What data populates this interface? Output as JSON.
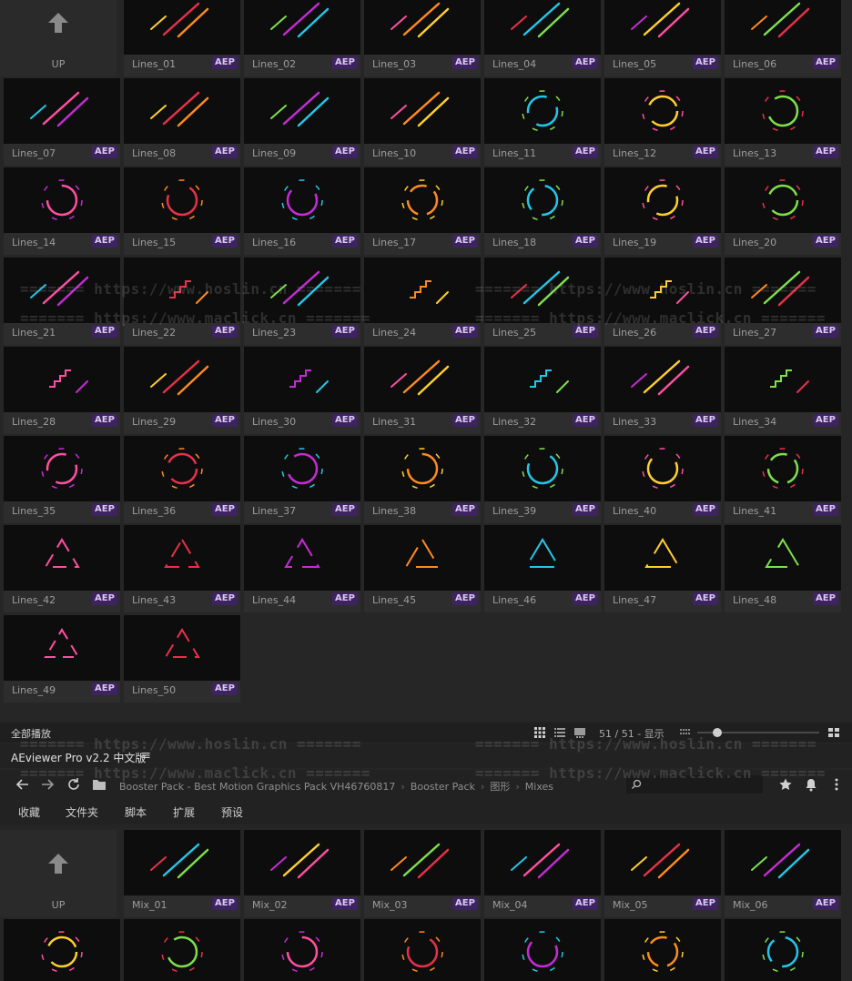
{
  "up_label": "UP",
  "badge": "AEP",
  "grid_top": [
    "Lines_01",
    "Lines_02",
    "Lines_03",
    "Lines_04",
    "Lines_05",
    "Lines_06",
    "Lines_07",
    "Lines_08",
    "Lines_09",
    "Lines_10",
    "Lines_11",
    "Lines_12",
    "Lines_13",
    "Lines_14",
    "Lines_15",
    "Lines_16",
    "Lines_17",
    "Lines_18",
    "Lines_19",
    "Lines_20",
    "Lines_21",
    "Lines_22",
    "Lines_23",
    "Lines_24",
    "Lines_25",
    "Lines_26",
    "Lines_27",
    "Lines_28",
    "Lines_29",
    "Lines_30",
    "Lines_31",
    "Lines_32",
    "Lines_33",
    "Lines_34",
    "Lines_35",
    "Lines_36",
    "Lines_37",
    "Lines_38",
    "Lines_39",
    "Lines_40",
    "Lines_41",
    "Lines_42",
    "Lines_43",
    "Lines_44",
    "Lines_45",
    "Lines_46",
    "Lines_47",
    "Lines_48",
    "Lines_49",
    "Lines_50"
  ],
  "status": {
    "left": "全部播放",
    "count": "51 / 51 - 显示"
  },
  "app": {
    "title": "AEviewer Pro v2.2  中文版",
    "menu": "≡"
  },
  "breadcrumb": [
    "Booster Pack - Best Motion Graphics Pack VH46760817",
    "Booster Pack",
    "图形",
    "Mixes"
  ],
  "search": {
    "placeholder": ""
  },
  "tabs": [
    "收藏",
    "文件夹",
    "脚本",
    "扩展",
    "预设"
  ],
  "grid_bottom": [
    "Mix_01",
    "Mix_02",
    "Mix_03",
    "Mix_04",
    "Mix_05",
    "Mix_06"
  ],
  "watermarks": {
    "hoslin": "======= https://www.hoslin.cn =======",
    "maclick": "======= https://www.maclick.cn ======="
  },
  "colors": {
    "badge_bg": "#3e2361",
    "thumb_bg": "#0d0d0d",
    "accent_red": "#e8304a",
    "accent_magenta": "#c52bd6",
    "accent_orange": "#ff8a1e",
    "accent_cyan": "#22c6e8"
  }
}
